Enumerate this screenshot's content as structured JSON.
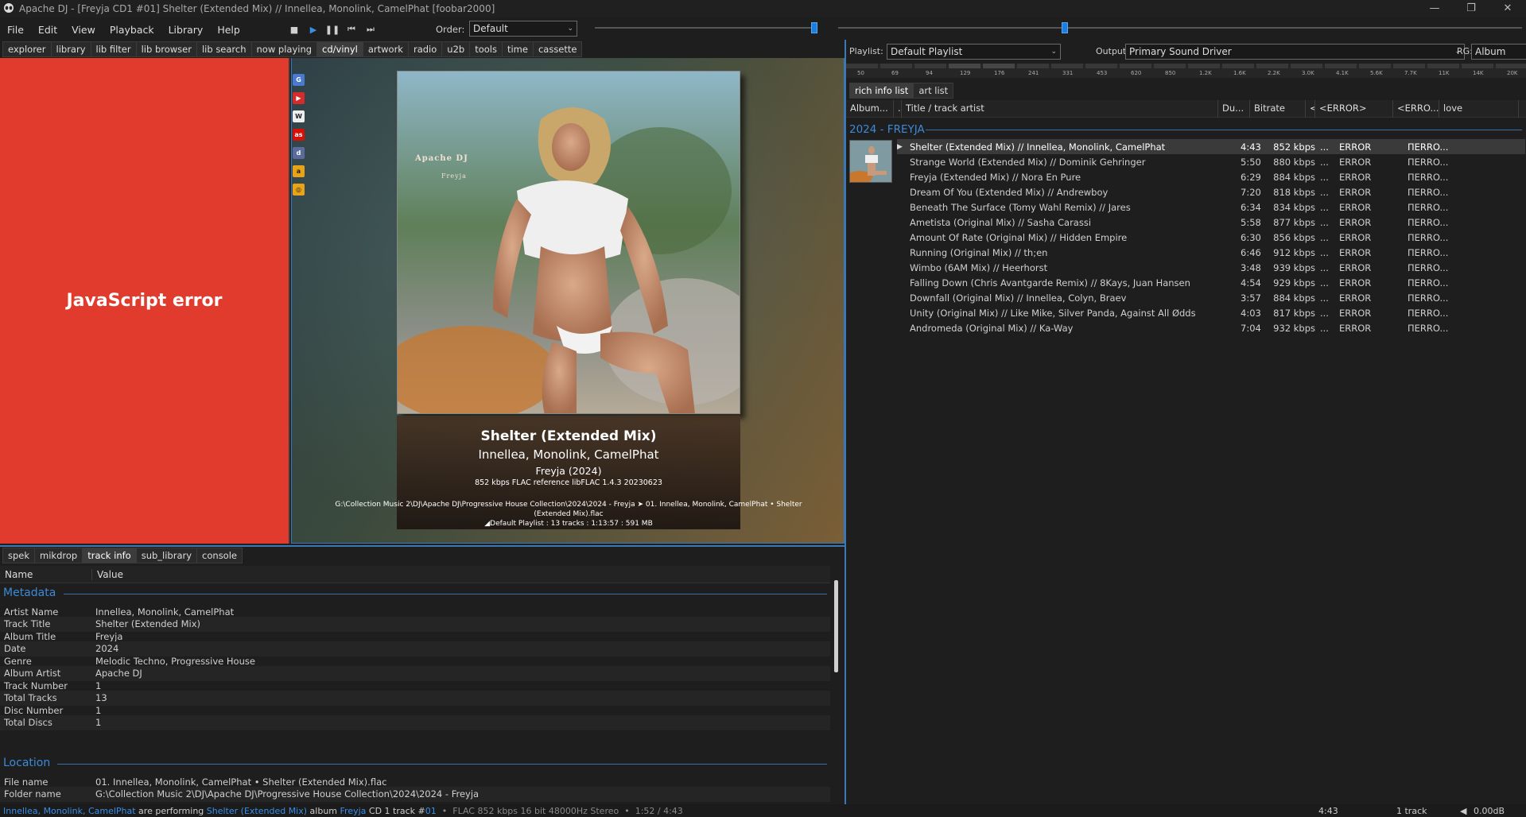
{
  "window": {
    "title": "Apache DJ - [Freyja CD1 #01] Shelter (Extended Mix) // Innellea, Monolink, CamelPhat  [foobar2000]",
    "minimize": "—",
    "maximize": "❐",
    "close": "✕"
  },
  "menu": [
    "File",
    "Edit",
    "View",
    "Playback",
    "Library",
    "Help"
  ],
  "transport": {
    "stop": "■",
    "play": "▶",
    "pause": "❚❚",
    "prev": "⏮",
    "next": "⏭"
  },
  "order": {
    "label": "Order:",
    "value": "Default"
  },
  "volume_level": 1.0,
  "seek_fraction": 0.33,
  "left_tabs": [
    {
      "label": "explorer"
    },
    {
      "label": "library"
    },
    {
      "label": "lib filter"
    },
    {
      "label": "lib browser"
    },
    {
      "label": "lib search"
    },
    {
      "label": "now playing"
    },
    {
      "label": "cd/vinyl",
      "active": true
    },
    {
      "label": "artwork"
    },
    {
      "label": "radio"
    },
    {
      "label": "u2b"
    },
    {
      "label": "tools"
    },
    {
      "label": "time"
    },
    {
      "label": "cassette"
    }
  ],
  "js_error": "JavaScript error",
  "cover_text": {
    "line1": "Apache DJ",
    "line2": "Freyja"
  },
  "now_playing": {
    "title": "Shelter (Extended Mix)",
    "artist": "Innellea, Monolink, CamelPhat",
    "album": "Freyja (2024)",
    "codec": "852 kbps FLAC reference libFLAC 1.4.3 20230623",
    "path": "G:\\Collection Music 2\\DJ\\Apache DJ\\Progressive House Collection\\2024\\2024 - Freyja ➤ 01. Innellea, Monolink, CamelPhat • Shelter (Extended Mix).flac",
    "playlist_summary": "◢Default Playlist : 13 tracks : 1:13:57 : 591 MB"
  },
  "bottom_tabs": [
    {
      "label": "spek"
    },
    {
      "label": "mikdrop"
    },
    {
      "label": "track info",
      "active": true
    },
    {
      "label": "sub_library"
    },
    {
      "label": "console"
    }
  ],
  "track_info": {
    "col_name": "Name",
    "col_value": "Value",
    "metadata_title": "Metadata",
    "metadata": [
      {
        "k": "Artist Name",
        "v": "Innellea, Monolink, CamelPhat"
      },
      {
        "k": "Track Title",
        "v": "Shelter (Extended Mix)"
      },
      {
        "k": "Album Title",
        "v": "Freyja"
      },
      {
        "k": "Date",
        "v": "2024"
      },
      {
        "k": "Genre",
        "v": "Melodic Techno, Progressive House"
      },
      {
        "k": "Album Artist",
        "v": "Apache DJ"
      },
      {
        "k": "Track Number",
        "v": "1"
      },
      {
        "k": "Total Tracks",
        "v": "13"
      },
      {
        "k": "Disc Number",
        "v": "1"
      },
      {
        "k": "Total Discs",
        "v": "1"
      }
    ],
    "location_title": "Location",
    "location": [
      {
        "k": "File name",
        "v": "01. Innellea, Monolink, CamelPhat • Shelter (Extended Mix).flac"
      },
      {
        "k": "Folder name",
        "v": "G:\\Collection Music 2\\DJ\\Apache DJ\\Progressive House Collection\\2024\\2024 - Freyja"
      }
    ]
  },
  "right_top": {
    "playlist_label": "Playlist:",
    "playlist_value": "Default Playlist",
    "output_label": "Output:",
    "output_value": "Primary Sound Driver",
    "rg_label": "RG:",
    "rg_value": "Album"
  },
  "spectrum_labels": [
    "50",
    "69",
    "94",
    "129",
    "176",
    "241",
    "331",
    "453",
    "620",
    "850",
    "1.2K",
    "1.6K",
    "2.2K",
    "3.0K",
    "4.1K",
    "5.6K",
    "7.7K",
    "11K",
    "14K",
    "20K"
  ],
  "right_tabs": [
    {
      "label": "rich info list",
      "active": true
    },
    {
      "label": "art list"
    }
  ],
  "playlist_headers": [
    "Album...",
    ".",
    "Title / track artist",
    "Du...",
    "Bitrate",
    "<",
    "<ERROR>",
    "<ERRO...",
    "love"
  ],
  "group_header": "2024 - FREYJA",
  "tracks": [
    {
      "title": "Shelter (Extended Mix) // Innellea, Monolink, CamelPhat",
      "dur": "4:43",
      "br": "852 kbps",
      "playing": true
    },
    {
      "title": "Strange World (Extended Mix) // Dominik Gehringer",
      "dur": "5:50",
      "br": "880 kbps"
    },
    {
      "title": "Freyja (Extended Mix) // Nora En Pure",
      "dur": "6:29",
      "br": "884 kbps"
    },
    {
      "title": "Dream Of You (Extended Mix) // Andrewboy",
      "dur": "7:20",
      "br": "818 kbps"
    },
    {
      "title": "Beneath The Surface (Tomy Wahl Remix) // Jares",
      "dur": "6:34",
      "br": "834 kbps"
    },
    {
      "title": "Ametista (Original Mix) // Sasha Carassi",
      "dur": "5:58",
      "br": "877 kbps"
    },
    {
      "title": "Amount Of Rate (Original Mix) // Hidden Empire",
      "dur": "6:30",
      "br": "856 kbps"
    },
    {
      "title": "Running (Original Mix) // th;en",
      "dur": "6:46",
      "br": "912 kbps"
    },
    {
      "title": "Wimbo (6AM Mix) // Heerhorst",
      "dur": "3:48",
      "br": "939 kbps"
    },
    {
      "title": "Falling Down (Chris Avantgarde Remix) // 8Kays, Juan Hansen",
      "dur": "4:54",
      "br": "929 kbps"
    },
    {
      "title": "Downfall (Original Mix) // Innellea, Colyn, Braev",
      "dur": "3:57",
      "br": "884 kbps"
    },
    {
      "title": "Unity (Original Mix) // Like Mike, Silver Panda, Against All Ødds",
      "dur": "4:03",
      "br": "817 kbps"
    },
    {
      "title": "Andromeda (Original Mix) // Ka-Way",
      "dur": "7:04",
      "br": "932 kbps"
    }
  ],
  "track_cells": {
    "ellipsis": "...",
    "error": "ERROR",
    "erro": "ΠERRO...",
    "play_marker": "▶"
  },
  "status": {
    "artist": "Innellea, Monolink, CamelPhat",
    "are_performing": " are performing ",
    "title": "Shelter (Extended Mix)",
    "album_word": " album ",
    "album": "Freyja",
    "cd_track": " CD 1 track #",
    "track_no": "01",
    "tech": "  •  FLAC 852 kbps 16 bit 48000Hz Stereo  •  1:52 / 4:43",
    "time": "4:43",
    "tracks": "1 track",
    "vol": "0.00dB"
  },
  "colors": {
    "accent": "#3a8ee6",
    "error_bg": "#e13b2d",
    "bg": "#1e1e1e"
  }
}
